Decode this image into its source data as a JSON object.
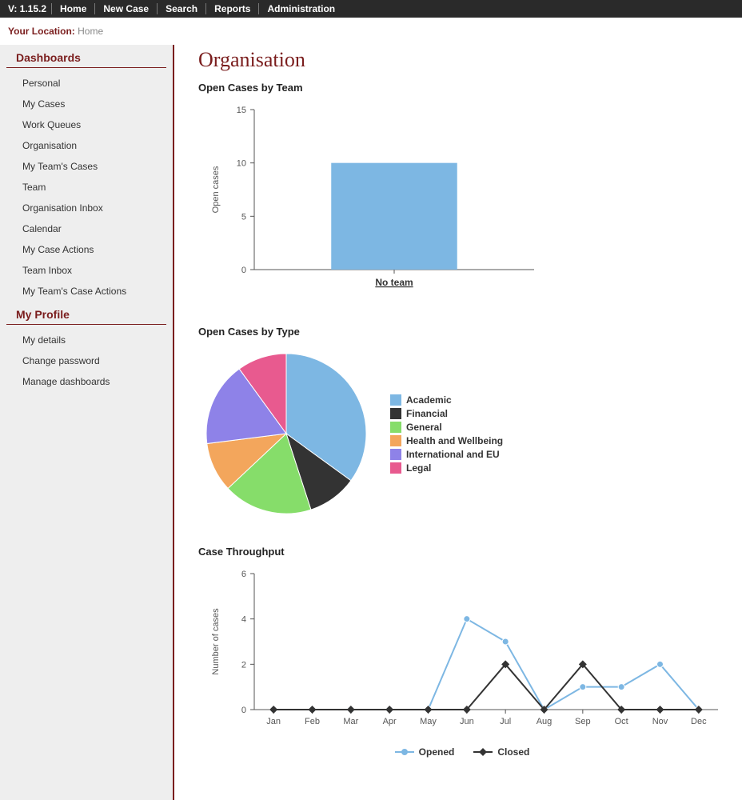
{
  "topnav": {
    "version": "V: 1.15.2",
    "items": [
      "Home",
      "New Case",
      "Search",
      "Reports",
      "Administration"
    ]
  },
  "breadcrumb": {
    "label": "Your Location:",
    "value": "Home"
  },
  "sidebar": {
    "sections": [
      {
        "heading": "Dashboards",
        "items": [
          "Personal",
          "My Cases",
          "Work Queues",
          "Organisation",
          "My Team's Cases",
          "Team",
          "Organisation Inbox",
          "Calendar",
          "My Case Actions",
          "Team Inbox",
          "My Team's Case Actions"
        ]
      },
      {
        "heading": "My Profile",
        "items": [
          "My details",
          "Change password",
          "Manage dashboards"
        ]
      }
    ]
  },
  "page": {
    "title": "Organisation"
  },
  "chart1": {
    "title": "Open Cases by Team"
  },
  "chart2": {
    "title": "Open Cases by Type"
  },
  "chart3": {
    "title": "Case Throughput"
  },
  "chart_data": [
    {
      "type": "bar",
      "title": "Open Cases by Team",
      "ylabel": "Open cases",
      "categories": [
        "No team"
      ],
      "values": [
        10
      ],
      "ylim": [
        0,
        15
      ],
      "yticks": [
        0,
        5,
        10,
        15
      ],
      "bar_color": "#7db7e3"
    },
    {
      "type": "pie",
      "title": "Open Cases by Type",
      "series": [
        {
          "name": "Academic",
          "value": 35,
          "color": "#7db7e3"
        },
        {
          "name": "Financial",
          "value": 10,
          "color": "#333333"
        },
        {
          "name": "General",
          "value": 18,
          "color": "#86dd6a"
        },
        {
          "name": "Health and Wellbeing",
          "value": 10,
          "color": "#f3a65c"
        },
        {
          "name": "International and EU",
          "value": 17,
          "color": "#8e82e8"
        },
        {
          "name": "Legal",
          "value": 10,
          "color": "#e85a8f"
        }
      ]
    },
    {
      "type": "line",
      "title": "Case Throughput",
      "ylabel": "Number of cases",
      "categories": [
        "Jan",
        "Feb",
        "Mar",
        "Apr",
        "May",
        "Jun",
        "Jul",
        "Aug",
        "Sep",
        "Oct",
        "Nov",
        "Dec"
      ],
      "ylim": [
        0,
        6
      ],
      "yticks": [
        0,
        2,
        4,
        6
      ],
      "series": [
        {
          "name": "Opened",
          "color": "#7db7e3",
          "marker": "circle",
          "values": [
            0,
            0,
            0,
            0,
            0,
            4,
            3,
            0,
            1,
            1,
            2,
            0
          ]
        },
        {
          "name": "Closed",
          "color": "#333333",
          "marker": "diamond",
          "values": [
            0,
            0,
            0,
            0,
            0,
            0,
            2,
            0,
            2,
            0,
            0,
            0
          ]
        }
      ]
    }
  ]
}
